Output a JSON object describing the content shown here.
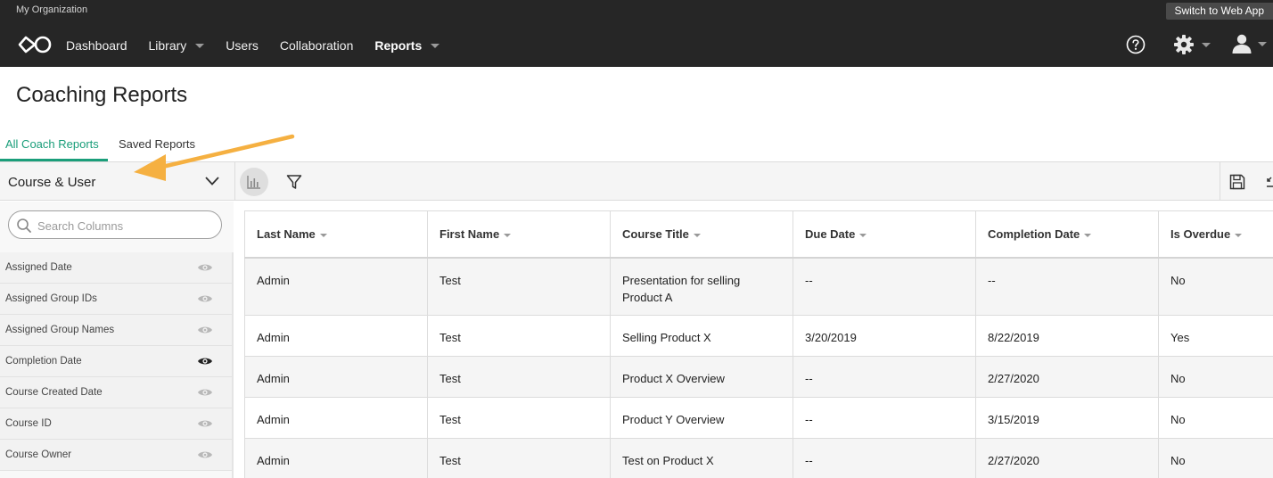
{
  "topbar": {
    "org_name": "My Organization",
    "switch_label": "Switch to Web App",
    "nav": [
      {
        "label": "Dashboard",
        "caret": false,
        "active": false
      },
      {
        "label": "Library",
        "caret": true,
        "active": false
      },
      {
        "label": "Users",
        "caret": false,
        "active": false
      },
      {
        "label": "Collaboration",
        "caret": false,
        "active": false
      },
      {
        "label": "Reports",
        "caret": true,
        "active": true
      }
    ],
    "icons": {
      "logo": "infinity-logo-icon",
      "help": "help-circle-icon",
      "settings": "gear-icon",
      "user": "user-icon"
    }
  },
  "page": {
    "title": "Coaching Reports",
    "tabs": [
      {
        "label": "All Coach Reports",
        "active": true
      },
      {
        "label": "Saved Reports",
        "active": false
      }
    ]
  },
  "toolbar": {
    "category": "Course & User",
    "icons": {
      "chart": "bar-chart-icon",
      "filter": "filter-icon",
      "save": "save-icon",
      "export": "export-icon"
    }
  },
  "sidebar": {
    "search_placeholder": "Search Columns",
    "columns": [
      {
        "label": "Assigned Date",
        "visible": false
      },
      {
        "label": "Assigned Group IDs",
        "visible": false
      },
      {
        "label": "Assigned Group Names",
        "visible": false
      },
      {
        "label": "Completion Date",
        "visible": true
      },
      {
        "label": "Course Created Date",
        "visible": false
      },
      {
        "label": "Course ID",
        "visible": false
      },
      {
        "label": "Course Owner",
        "visible": false
      }
    ]
  },
  "table": {
    "headers": [
      "Last Name",
      "First Name",
      "Course Title",
      "Due Date",
      "Completion Date",
      "Is Overdue"
    ],
    "rows": [
      [
        "Admin",
        "Test",
        "Presentation for selling Product A",
        "--",
        "--",
        "No"
      ],
      [
        "Admin",
        "Test",
        "Selling Product X",
        "3/20/2019",
        "8/22/2019",
        "Yes"
      ],
      [
        "Admin",
        "Test",
        "Product X Overview",
        "--",
        "2/27/2020",
        "No"
      ],
      [
        "Admin",
        "Test",
        "Product Y Overview",
        "--",
        "3/15/2019",
        "No"
      ],
      [
        "Admin",
        "Test",
        "Test on Product X",
        "--",
        "2/27/2020",
        "No"
      ]
    ]
  },
  "colors": {
    "topbar": "#262626",
    "accent": "#1a9e7a",
    "annotation_arrow": "#f5b041",
    "visible_eye": "#222222",
    "hidden_eye": "#b8b8b8"
  }
}
